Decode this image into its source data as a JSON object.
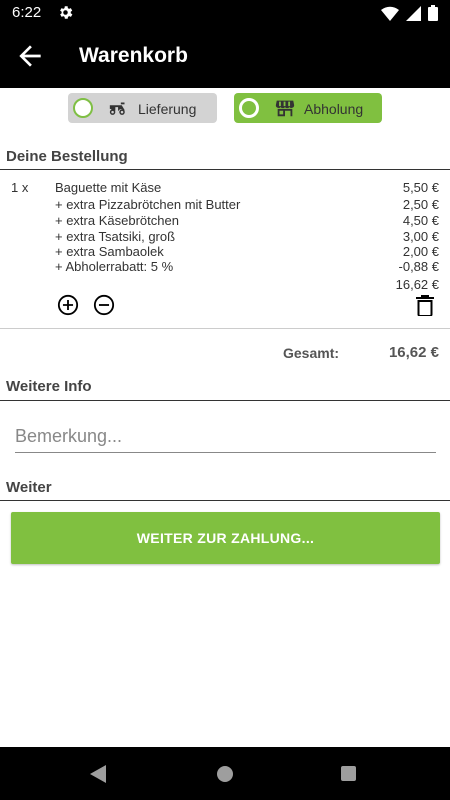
{
  "status": {
    "time": "6:22"
  },
  "header": {
    "title": "Warenkorb"
  },
  "delivery_toggle": {
    "lieferung_label": "Lieferung",
    "abholung_label": "Abholung",
    "selected": "Abholung"
  },
  "order": {
    "section_title": "Deine Bestellung",
    "quantity": "1 x",
    "lines": [
      {
        "name": "Baguette mit Käse",
        "price": "5,50 €"
      },
      {
        "name": "+ extra Pizzabrötchen mit Butter",
        "price": "2,50 €"
      },
      {
        "name": "+ extra Käsebrötchen",
        "price": "4,50 €"
      },
      {
        "name": "+ extra Tsatsiki, groß",
        "price": "3,00 €"
      },
      {
        "name": "+ extra Sambaolek",
        "price": "2,00 €"
      },
      {
        "name": "+ Abholerrabatt: 5 %",
        "price": "-0,88 €"
      }
    ],
    "item_total": "16,62 €"
  },
  "totals": {
    "label": "Gesamt:",
    "value": "16,62 €"
  },
  "info": {
    "section_title": "Weitere Info",
    "remark_placeholder": "Bemerkung..."
  },
  "next": {
    "section_title": "Weiter",
    "button_label": "WEITER ZUR ZAHLUNG..."
  },
  "colors": {
    "accent": "#80c040",
    "inactive_toggle": "#d3d3d3",
    "bar": "#000000"
  }
}
